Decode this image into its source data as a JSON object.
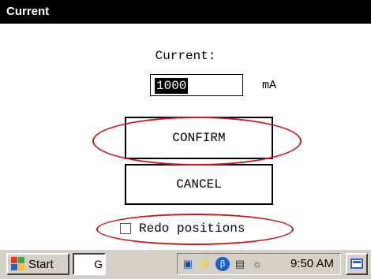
{
  "window": {
    "title": "Current"
  },
  "form": {
    "current_label": "Current:",
    "current_value": "1000",
    "unit": "mA",
    "confirm_label": "CONFIRM",
    "cancel_label": "CANCEL",
    "redo_label": "Redo positions",
    "redo_checked": false
  },
  "taskbar": {
    "start_label": "Start",
    "task_button_text": "G",
    "tray_icons": [
      "network-icon",
      "power-icon",
      "bluetooth-icon",
      "volume-icon",
      "signal-icon"
    ],
    "clock": "9:50 AM"
  },
  "colors": {
    "titlebar": "#000000",
    "annotation": "#cc1a1a",
    "taskbar": "#d4d0c8"
  }
}
